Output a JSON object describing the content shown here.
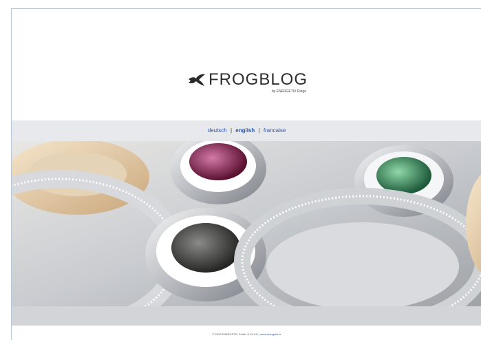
{
  "header": {
    "logo_text": "FROGBLOG",
    "logo_subtitle": "by ENERGETIX Ringe"
  },
  "nav": {
    "languages": [
      "deutsch",
      "english",
      "francaise"
    ],
    "separator": "|",
    "active": "english"
  },
  "hero": {
    "icon": "jewelry-rings-photo"
  },
  "footer": {
    "copyright": "© 2012 ENERGETIX GmbH & Co.KG |",
    "link": "www.energetix.tv"
  },
  "colors": {
    "link": "#2b56b8",
    "band": "#e8e9ec",
    "frame_border": "#b9c7d6"
  }
}
